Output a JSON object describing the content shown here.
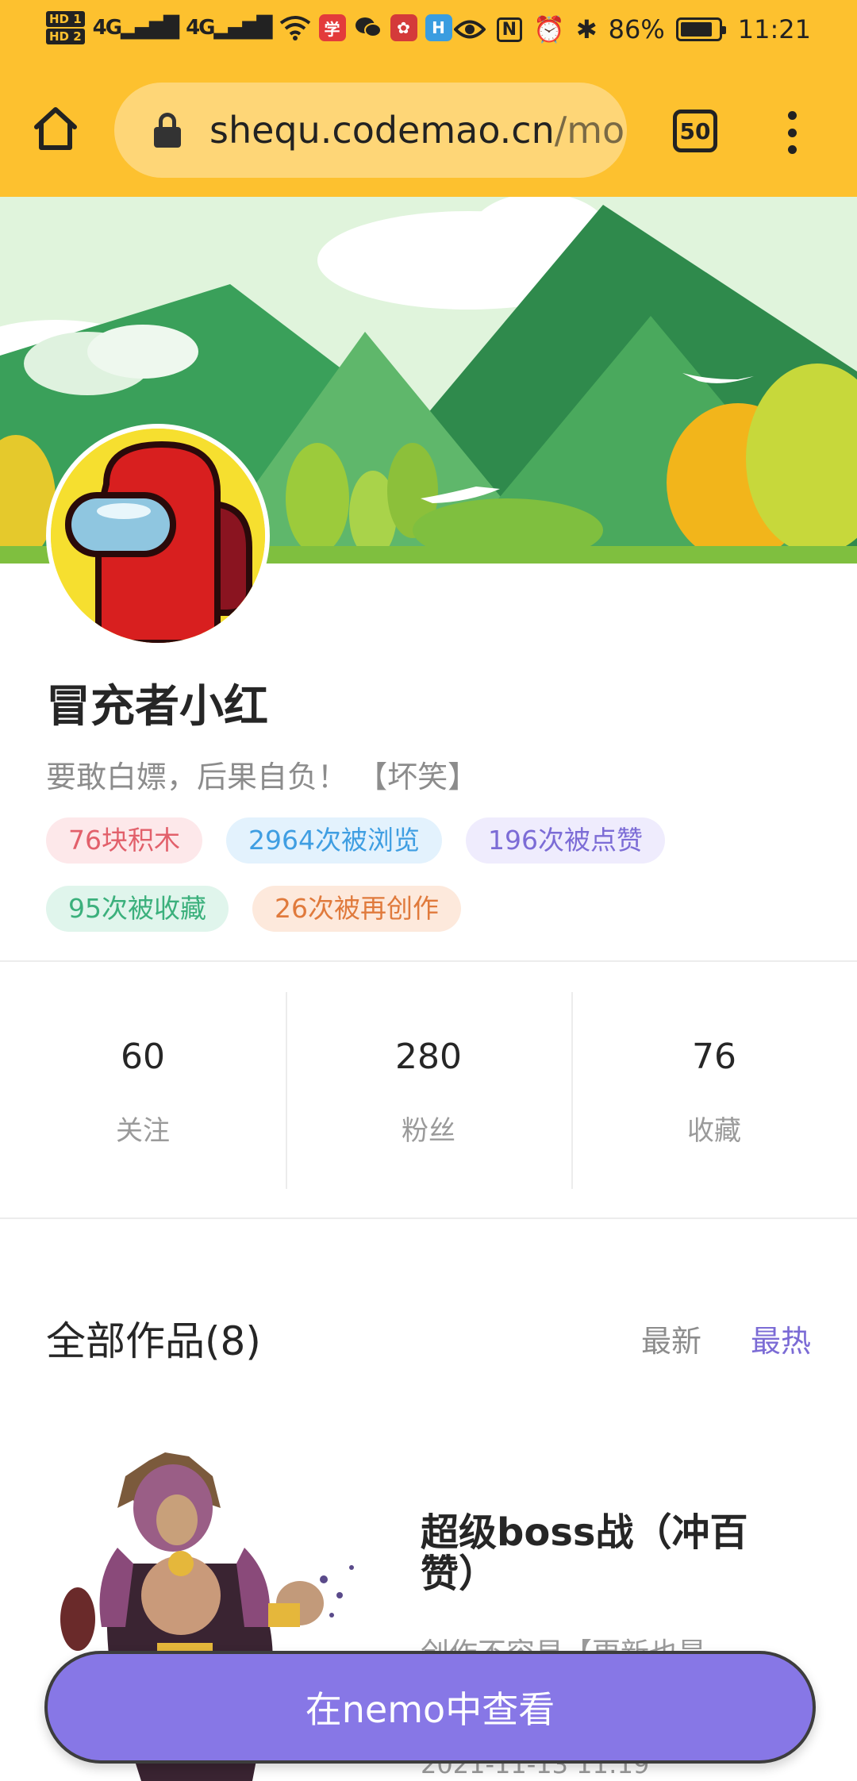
{
  "status_bar": {
    "hd1": "HD 1",
    "hd2": "HD 2",
    "net1": "4G",
    "net2": "4G",
    "app1": "学",
    "battery_text": "86%",
    "battery_level": 0.86,
    "time": "11:21"
  },
  "browser": {
    "url_host": "shequ.codemao.cn",
    "url_rest": "/mo",
    "tab_count": "50"
  },
  "profile": {
    "username": "冒充者小红",
    "bio": "要敢白嫖，后果自负！ 【坏笑】",
    "tags": [
      "76块积木",
      "2964次被浏览",
      "196次被点赞",
      "95次被收藏",
      "26次被再创作"
    ]
  },
  "stats": [
    {
      "value": "60",
      "label": "关注"
    },
    {
      "value": "280",
      "label": "粉丝"
    },
    {
      "value": "76",
      "label": "收藏"
    }
  ],
  "works": {
    "title": "全部作品(8)",
    "sort_new": "最新",
    "sort_hot": "最热",
    "items": [
      {
        "title": "超级boss战（冲百赞）",
        "desc": "创作不容易【更新也是",
        "date": "2021-11-13 11:19"
      }
    ]
  },
  "cta": {
    "label": "在nemo中查看"
  },
  "colors": {
    "chrome": "#fdc12f",
    "accent": "#8777e6",
    "sort_active": "#7b6bd5"
  }
}
